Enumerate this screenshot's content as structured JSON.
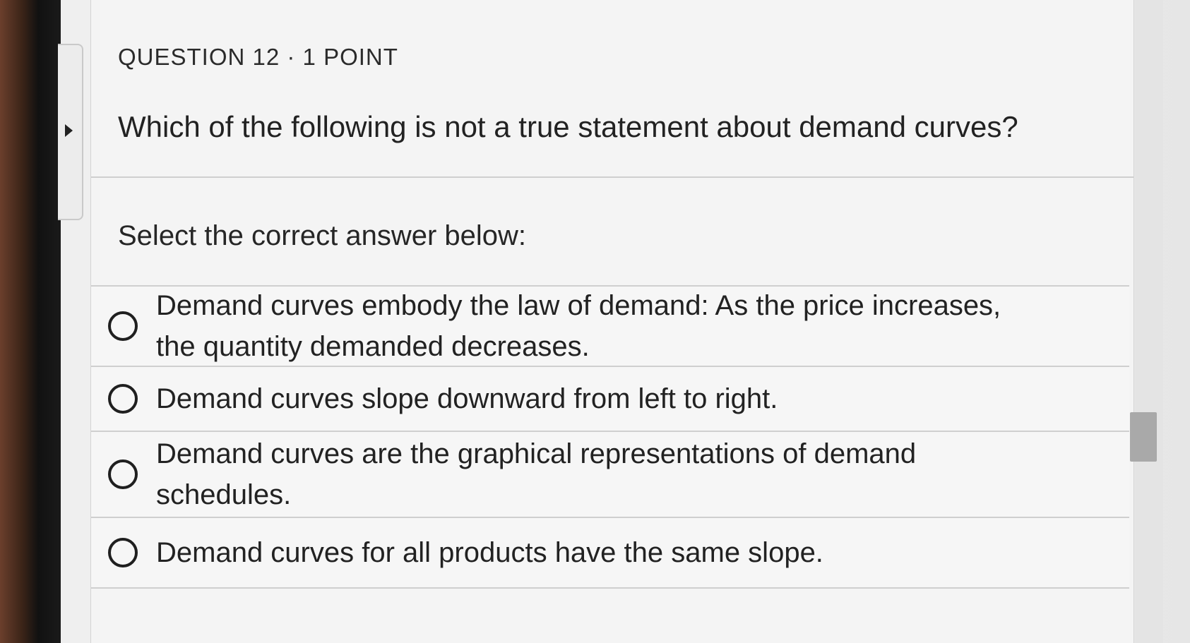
{
  "question": {
    "label": "QUESTION 12 · 1 POINT",
    "text": "Which of the following is not a true statement about demand curves?"
  },
  "instruction": "Select the correct answer below:",
  "options": [
    "Demand curves embody the law of demand: As the price increases, the quantity demanded decreases.",
    "Demand curves slope downward from left to right.",
    "Demand curves are the graphical representations of demand schedules.",
    "Demand curves for all products have the same slope."
  ],
  "icons": {
    "collapse": "caret-right-icon",
    "radio": "radio-unselected-icon"
  }
}
